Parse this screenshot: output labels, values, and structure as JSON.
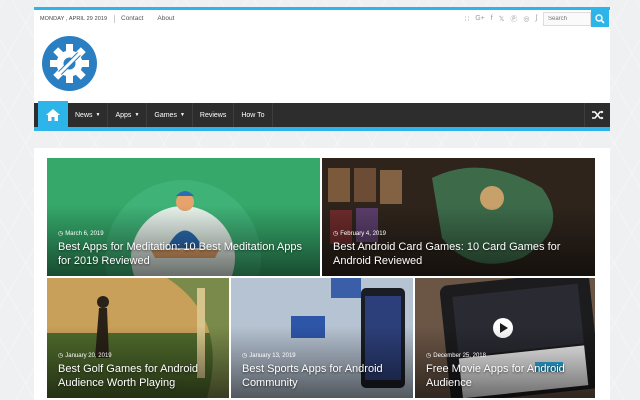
{
  "topbar": {
    "date": "MONDAY , APRIL 29 2019",
    "links": [
      "Contact",
      "About"
    ],
    "search_placeholder": "Search"
  },
  "nav": {
    "items": [
      "News",
      "Apps",
      "Games",
      "Reviews",
      "How To"
    ]
  },
  "colors": {
    "accent": "#2db4e8",
    "nav_bg": "#2d2d2d",
    "logo": "#2a7fc3"
  },
  "icons": [
    "rss-icon",
    "google-plus-icon",
    "facebook-icon",
    "twitter-icon",
    "pinterest-icon",
    "dribbble-icon",
    "stumbleupon-icon",
    "search-icon",
    "home-icon",
    "shuffle-icon",
    "clock-icon"
  ],
  "posts": [
    {
      "date": "March 6, 2019",
      "title": "Best Apps for Meditation: 10 Best Meditation Apps for 2019 Reviewed"
    },
    {
      "date": "February 4, 2019",
      "title": "Best Android Card Games: 10 Card Games for Android Reviewed"
    },
    {
      "date": "January 20, 2019",
      "title": "Best Golf Games for Android Audience Worth Playing"
    },
    {
      "date": "January 13, 2019",
      "title": "Best Sports Apps for Android Community"
    },
    {
      "date": "December 25, 2018",
      "title": "Free Movie Apps for Android Audience"
    }
  ]
}
